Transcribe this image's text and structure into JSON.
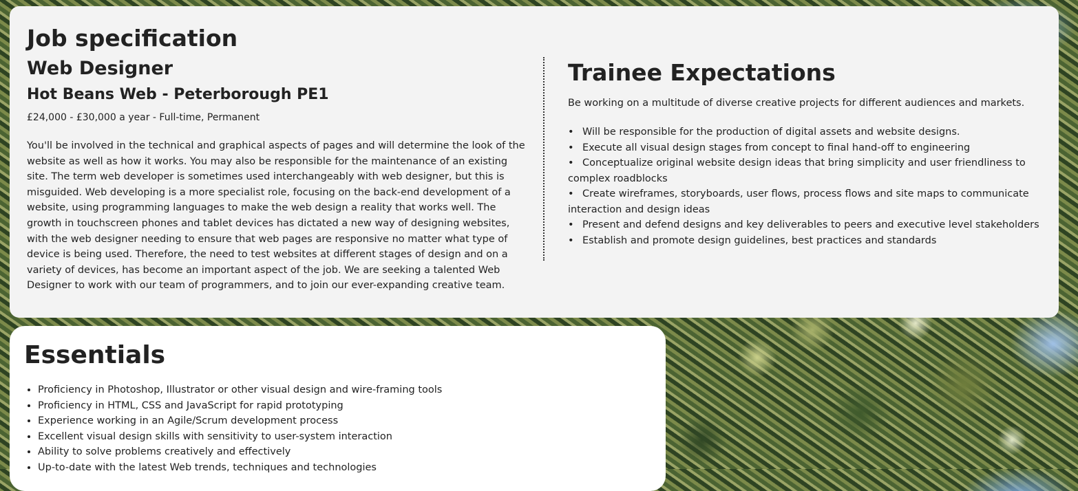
{
  "job_spec": {
    "heading": "Job specification",
    "job_title": "Web Designer",
    "company": "Hot Beans Web - Peterborough PE1",
    "salary": "£24,000 - £30,000 a year - Full-time, Permanent",
    "description": "You'll be involved in the technical and graphical aspects of pages and will determine the look of the website as well as how it works. You may also be responsible for the maintenance of an existing site. The term web developer is sometimes used interchangeably with web designer, but this is misguided. Web developing is a more specialist role, focusing on the back-end development of a website, using programming languages to make the web design a reality that works well. The growth in touchscreen phones and tablet devices has dictated a new way of designing websites, with the web designer needing to ensure that web pages are responsive no matter what type of device is being used. Therefore, the need to test websites at different stages of design and on a variety of devices, has become an important aspect of the job. We are seeking a talented Web Designer to work with our team of programmers, and to join our ever-expanding creative team."
  },
  "trainee": {
    "heading": "Trainee Expectations",
    "intro": "Be working on a multitude of diverse creative projects for different audiences and markets.",
    "items": [
      "Will be responsible for the production of digital assets and website designs.",
      "Execute all visual design stages from concept to final hand-off to engineering",
      "Conceptualize original website design ideas that bring simplicity and user friendliness to complex roadblocks",
      "Create wireframes, storyboards, user flows, process flows and site maps to communicate interaction and design ideas",
      "Present and defend designs and key deliverables to peers and executive level stakeholders",
      "Establish and promote design guidelines, best practices and standards"
    ]
  },
  "essentials": {
    "heading": "Essentials",
    "items": [
      "Proficiency in Photoshop, Illustrator or other visual design and wire-framing tools",
      "Proficiency in HTML, CSS and JavaScript for rapid prototyping",
      "Experience working in an Agile/Scrum development process",
      "Excellent visual design skills with sensitivity to user-system interaction",
      "Ability to solve problems creatively and effectively",
      "Up-to-date with the latest Web trends, techniques and technologies"
    ]
  }
}
